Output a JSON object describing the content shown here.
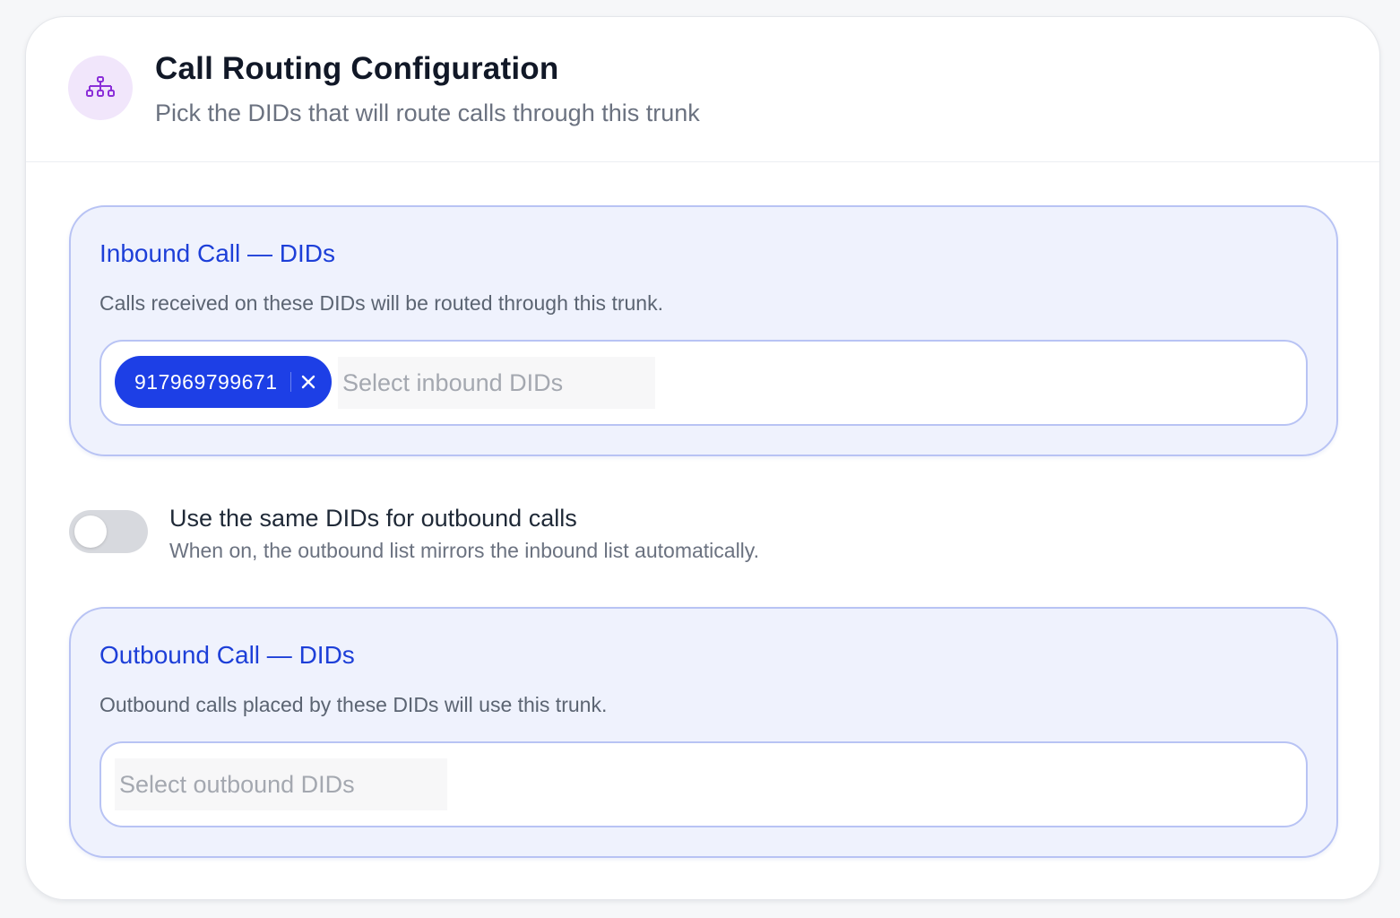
{
  "header": {
    "icon": "sitemap-icon",
    "title": "Call Routing Configuration",
    "subtitle": "Pick the DIDs that will route calls through this trunk"
  },
  "inbound": {
    "title": "Inbound Call — DIDs",
    "description": "Calls received on these DIDs will be routed through this trunk.",
    "selected": [
      "917969799671"
    ],
    "placeholder": "Select inbound DIDs"
  },
  "toggle": {
    "label": "Use the same DIDs for outbound calls",
    "hint": "When on, the outbound list mirrors the inbound list automatically.",
    "on": false
  },
  "outbound": {
    "title": "Outbound Call — DIDs",
    "description": "Outbound calls placed by these DIDs will use this trunk.",
    "selected": [],
    "placeholder": "Select outbound DIDs"
  },
  "colors": {
    "accent": "#1d3fe6",
    "section_bg": "#eff2fd",
    "section_border": "#b8c3f4",
    "icon_bg": "#f1e6fb",
    "icon_stroke": "#8b2fd8"
  }
}
